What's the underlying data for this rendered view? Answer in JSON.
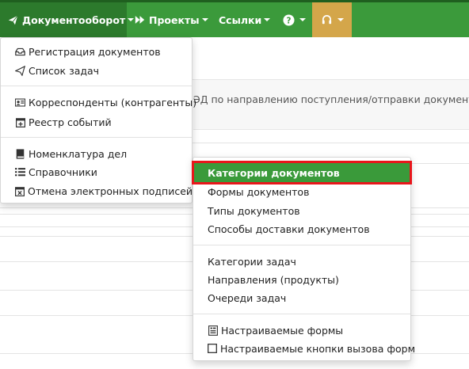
{
  "navbar": {
    "items": [
      {
        "label": "Документооборот",
        "icon": "paper-plane-icon"
      },
      {
        "label": "Проекты",
        "icon": "fast-forward-icon"
      },
      {
        "label": "Ссылки",
        "icon": ""
      },
      {
        "label": "?",
        "icon": "question-circle-icon"
      },
      {
        "label": "",
        "icon": "headset-icon"
      }
    ]
  },
  "page": {
    "description_fragment": "ЭД по направлению поступления/отправки документа."
  },
  "docflow_menu": {
    "items": [
      {
        "label": "Регистрация документов",
        "icon": "inbox-icon"
      },
      {
        "label": "Список задач",
        "icon": "paper-plane-outline-icon"
      },
      {
        "label": "Корреспонденты (контрагенты)",
        "icon": "contact-card-icon"
      },
      {
        "label": "Реестр событий",
        "icon": "calendar-plus-icon"
      },
      {
        "label": "Номенклатура дел",
        "icon": "book-icon"
      },
      {
        "label": "Справочники",
        "icon": "list-icon"
      },
      {
        "label": "Отмена электронных подписей",
        "icon": "calendar-x-icon"
      }
    ]
  },
  "handbooks_menu": {
    "items": [
      {
        "label": "Категории документов",
        "active": true
      },
      {
        "label": "Формы документов"
      },
      {
        "label": "Типы документов"
      },
      {
        "label": "Способы доставки документов"
      },
      {
        "label": "Категории задач"
      },
      {
        "label": "Направления (продукты)"
      },
      {
        "label": "Очереди задач"
      },
      {
        "label": "Настраиваемые формы",
        "icon": "form-icon"
      },
      {
        "label": "Настраиваемые кнопки вызова форм",
        "icon": "checkbox-icon"
      }
    ]
  },
  "colors": {
    "navbar": "#3b9a3b",
    "navbar_active": "#2c7a2c",
    "support_button": "#d4a64a",
    "highlight_outline": "#e8161b"
  }
}
